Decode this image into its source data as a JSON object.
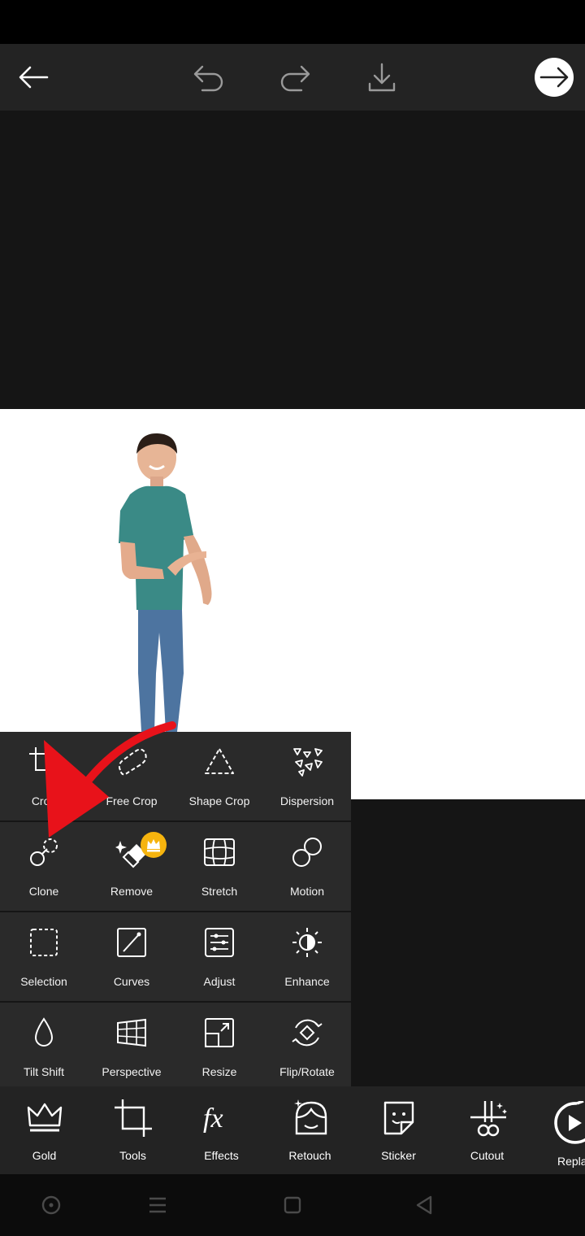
{
  "topbar": {
    "back_icon": "arrow-left-icon",
    "undo_icon": "undo-icon",
    "redo_icon": "redo-icon",
    "download_icon": "download-icon",
    "next_icon": "arrow-right-circle-icon"
  },
  "tools_menu": {
    "items": [
      {
        "label": "Crop",
        "icon": "crop-icon"
      },
      {
        "label": "Free Crop",
        "icon": "free-crop-icon"
      },
      {
        "label": "Shape Crop",
        "icon": "shape-crop-icon"
      },
      {
        "label": "Dispersion",
        "icon": "dispersion-icon"
      },
      {
        "label": "Clone",
        "icon": "clone-icon"
      },
      {
        "label": "Remove",
        "icon": "remove-icon",
        "premium": true
      },
      {
        "label": "Stretch",
        "icon": "stretch-icon"
      },
      {
        "label": "Motion",
        "icon": "motion-icon"
      },
      {
        "label": "Selection",
        "icon": "selection-icon"
      },
      {
        "label": "Curves",
        "icon": "curves-icon"
      },
      {
        "label": "Adjust",
        "icon": "adjust-icon"
      },
      {
        "label": "Enhance",
        "icon": "enhance-icon"
      },
      {
        "label": "Tilt Shift",
        "icon": "tilt-shift-icon"
      },
      {
        "label": "Perspective",
        "icon": "perspective-icon"
      },
      {
        "label": "Resize",
        "icon": "resize-icon"
      },
      {
        "label": "Flip/Rotate",
        "icon": "flip-rotate-icon"
      }
    ]
  },
  "bottom_toolbar": {
    "items": [
      {
        "label": "Gold",
        "icon": "crown-icon"
      },
      {
        "label": "Tools",
        "icon": "crop-tools-icon"
      },
      {
        "label": "Effects",
        "icon": "fx-icon"
      },
      {
        "label": "Retouch",
        "icon": "retouch-face-icon"
      },
      {
        "label": "Sticker",
        "icon": "sticker-icon"
      },
      {
        "label": "Cutout",
        "icon": "cutout-scissors-icon"
      },
      {
        "label": "Repla",
        "icon": "replay-icon"
      }
    ]
  },
  "colors": {
    "accent_arrow": "#e8121a",
    "premium_badge": "#f6b40e",
    "panel": "#2a2a2a",
    "bar": "#232323"
  }
}
